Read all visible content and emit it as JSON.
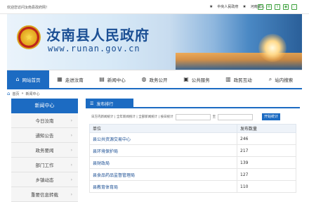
{
  "topbar": {
    "welcome": "欢迎您访问汝南县政府网！",
    "links": [
      "中央人民政府",
      "河南省人"
    ]
  },
  "banner": {
    "title": "汝南县人民政府",
    "url": "www.runan.gov.cn"
  },
  "nav": [
    {
      "label": "网站首页",
      "icon": "home-icon",
      "active": true
    },
    {
      "label": "走进汝南",
      "icon": "building-icon"
    },
    {
      "label": "新闻中心",
      "icon": "news-icon"
    },
    {
      "label": "政务公开",
      "icon": "gov-icon"
    },
    {
      "label": "公共服务",
      "icon": "service-icon"
    },
    {
      "label": "政民互动",
      "icon": "chat-icon"
    },
    {
      "label": "站内搜索",
      "icon": "search-icon"
    }
  ],
  "breadcrumb": {
    "home": "首页",
    "current": "新闻中心"
  },
  "sidebar": {
    "title": "新闻中心",
    "items": [
      "今日汝南",
      "通知公告",
      "政务要闻",
      "部门工作",
      "乡镇动态",
      "重要信息转载"
    ]
  },
  "main": {
    "tab": "发布排行",
    "filter_text": "日方内新闻统计 | 全年新闻统计 | 全部新闻统计 | 按日统计",
    "date_from": "",
    "date_to_label": "至",
    "date_to": "",
    "button": "开始统计",
    "columns": [
      "单位",
      "发布数量"
    ],
    "rows": [
      {
        "unit": "县公共资源交易中心",
        "count": "246"
      },
      {
        "unit": "县环境保护局",
        "count": "217"
      },
      {
        "unit": "县财政局",
        "count": "139"
      },
      {
        "unit": "县食品药品监督管理局",
        "count": "127"
      },
      {
        "unit": "县教育体育局",
        "count": "110"
      }
    ]
  }
}
